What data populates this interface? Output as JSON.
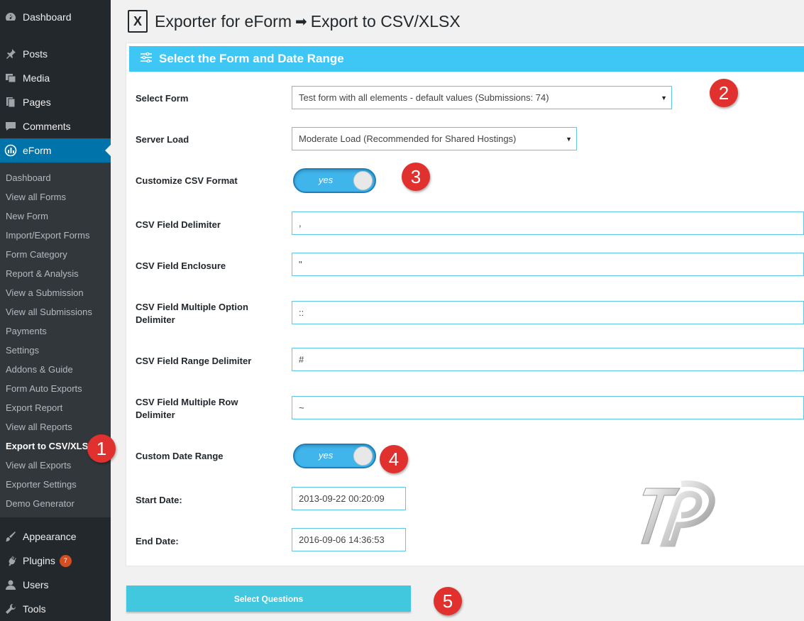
{
  "sidebar": {
    "top_before": [
      {
        "label": "Dashboard",
        "icon": "dashboard-icon"
      },
      {
        "label": "Posts",
        "icon": "pin-icon"
      },
      {
        "label": "Media",
        "icon": "media-icon"
      },
      {
        "label": "Pages",
        "icon": "pages-icon"
      },
      {
        "label": "Comments",
        "icon": "comment-icon"
      },
      {
        "label": "eForm",
        "icon": "eform-icon"
      }
    ],
    "submenu": [
      "Dashboard",
      "View all Forms",
      "New Form",
      "Import/Export Forms",
      "Form Category",
      "Report & Analysis",
      "View a Submission",
      "View all Submissions",
      "Payments",
      "Settings",
      "Addons & Guide",
      "Form Auto Exports",
      "Export Report",
      "View all Reports",
      "Export to CSV/XLSX",
      "View all Exports",
      "Exporter Settings",
      "Demo Generator"
    ],
    "top_after": [
      {
        "label": "Appearance",
        "icon": "brush-icon"
      },
      {
        "label": "Plugins",
        "icon": "plug-icon",
        "badge": "7"
      },
      {
        "label": "Users",
        "icon": "user-icon"
      },
      {
        "label": "Tools",
        "icon": "wrench-icon"
      }
    ]
  },
  "page": {
    "title_part1": "Exporter for eForm",
    "title_part2": "Export to CSV/XLSX",
    "panel_title": "Select the Form and Date Range"
  },
  "form": {
    "select_form_label": "Select Form",
    "select_form_value": "Test form with all elements - default values (Submissions: 74)",
    "server_load_label": "Server Load",
    "server_load_value": "Moderate Load (Recommended for Shared Hostings)",
    "customize_label": "Customize CSV Format",
    "customize_toggle": "yes",
    "delimiter_label": "CSV Field Delimiter",
    "delimiter_value": ",",
    "enclosure_label": "CSV Field Enclosure",
    "enclosure_value": "\"",
    "multi_option_label_1": "CSV Field Multiple Option",
    "multi_option_label_2": "Delimiter",
    "multi_option_value": "::",
    "range_label": "CSV Field Range Delimiter",
    "range_value": "#",
    "multi_row_label_1": "CSV Field Multiple Row",
    "multi_row_label_2": "Delimiter",
    "multi_row_value": "~",
    "date_range_label": "Custom Date Range",
    "date_range_toggle": "yes",
    "start_label": "Start Date:",
    "start_value": "2013-09-22 00:20:09",
    "end_label": "End Date:",
    "end_value": "2016-09-06 14:36:53"
  },
  "button": {
    "select_questions": "Select Questions"
  },
  "markers": [
    "1",
    "2",
    "3",
    "4",
    "5"
  ],
  "colors": {
    "accent": "#3ec6f5",
    "active_menu": "#0073aa",
    "marker": "#e0312e",
    "button": "#41c8de"
  }
}
